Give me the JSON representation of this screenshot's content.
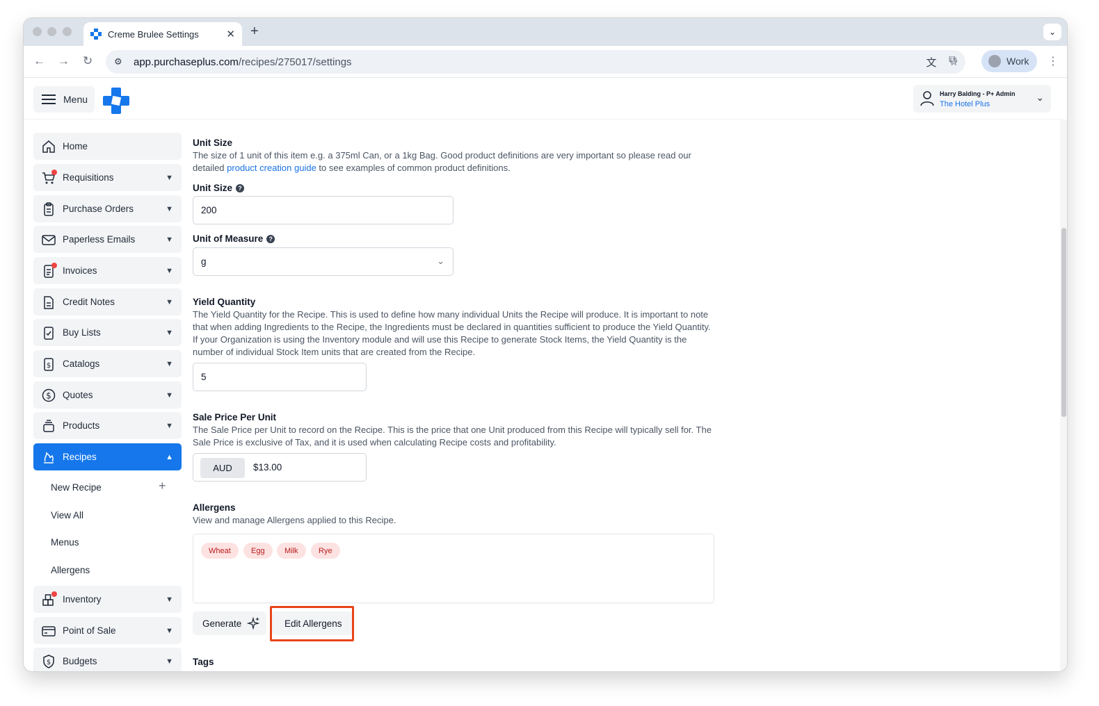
{
  "browser": {
    "tab_title": "Creme Brulee Settings",
    "tab_close": "✕",
    "new_tab": "+",
    "url_host": "app.purchaseplus.com",
    "url_path": "/recipes/275017/settings",
    "profile_label": "Work"
  },
  "header": {
    "menu_label": "Menu",
    "user_name": "Harry Balding - P+ Admin",
    "user_org": "The Hotel Plus"
  },
  "sidebar": {
    "items": [
      {
        "label": "Home",
        "icon": "home-icon"
      },
      {
        "label": "Requisitions",
        "icon": "cart-icon"
      },
      {
        "label": "Purchase Orders",
        "icon": "clipboard-icon"
      },
      {
        "label": "Paperless Emails",
        "icon": "envelope-icon"
      },
      {
        "label": "Invoices",
        "icon": "invoice-icon"
      },
      {
        "label": "Credit Notes",
        "icon": "document-icon"
      },
      {
        "label": "Buy Lists",
        "icon": "checklist-icon"
      },
      {
        "label": "Catalogs",
        "icon": "catalog-icon"
      },
      {
        "label": "Quotes",
        "icon": "dollar-circle-icon"
      },
      {
        "label": "Products",
        "icon": "stack-icon"
      },
      {
        "label": "Recipes",
        "icon": "flame-icon"
      },
      {
        "label": "Inventory",
        "icon": "inventory-icon"
      },
      {
        "label": "Point of Sale",
        "icon": "credit-card-icon"
      },
      {
        "label": "Budgets",
        "icon": "shield-dollar-icon"
      }
    ],
    "recipes_sub": {
      "new_recipe": "New Recipe",
      "view_all": "View All",
      "menus": "Menus",
      "allergens": "Allergens"
    }
  },
  "form": {
    "unit_size_section": {
      "title": "Unit Size",
      "desc_pre": "The size of 1 unit of this item e.g. a 375ml Can, or a 1kg Bag. Good product definitions are very important so please read our detailed ",
      "desc_link": "product creation guide",
      "desc_post": " to see examples of common product definitions."
    },
    "unit_size_label": "Unit Size",
    "unit_size_value": "200",
    "uom_label": "Unit of Measure",
    "uom_value": "g",
    "yield": {
      "title": "Yield Quantity",
      "desc": "The Yield Quantity for the Recipe. This is used to define how many individual Units the Recipe will produce. It is important to note that when adding Ingredients to the Recipe, the Ingredients must be declared in quantities sufficient to produce the Yield Quantity. If your Organization is using the Inventory module and will use this Recipe to generate Stock Items, the Yield Quantity is the number of individual Stock Item units that are created from the Recipe.",
      "value": "5"
    },
    "sale_price": {
      "title": "Sale Price Per Unit",
      "desc": "The Sale Price per Unit to record on the Recipe. This is the price that one Unit produced from this Recipe will typically sell for. The Sale Price is exclusive of Tax, and it is used when calculating Recipe costs and profitability.",
      "currency": "AUD",
      "value": "$13.00"
    },
    "allergens": {
      "title": "Allergens",
      "desc": "View and manage Allergens applied to this Recipe.",
      "chips": [
        "Wheat",
        "Egg",
        "Milk",
        "Rye"
      ],
      "generate_label": "Generate",
      "edit_label": "Edit Allergens"
    },
    "tags": {
      "title": "Tags"
    }
  },
  "colors": {
    "brand_blue": "#1577eb",
    "highlight": "#e8441a",
    "chip_bg": "#fde2e2",
    "chip_text": "#b91c1c"
  }
}
